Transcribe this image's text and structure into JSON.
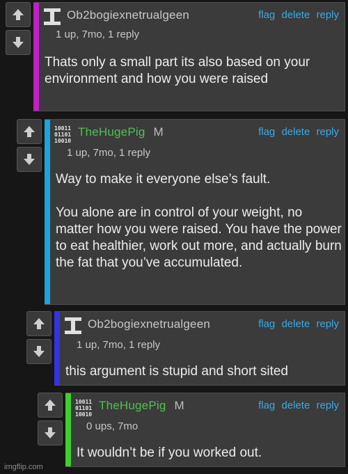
{
  "comments": [
    {
      "username": "Ob2bogiexnetrualgeen",
      "badge": "",
      "meta": "1 up, 7mo, 1 reply",
      "text": "Thats only a small part its also based on your environment and how you were raised",
      "stripe_color": "#c21fc6",
      "username_color": "#c8c8c8",
      "avatar": "i-beam-avatar"
    },
    {
      "username": "TheHugePig",
      "badge": "M",
      "meta": "1 up, 7mo, 1 reply",
      "text": "Way to make it everyone else’s fault.\n\nYou alone are in control of your weight, no matter how you were raised. You have the power to eat healthier, work out more, and actually burn the fat that you’ve accumulated.",
      "stripe_color": "#1ea3db",
      "username_color": "#4fc24f",
      "avatar": "binary-avatar"
    },
    {
      "username": "Ob2bogiexnetrualgeen",
      "badge": "",
      "meta": "1 up, 7mo, 1 reply",
      "text": "this argument is stupid and short sited",
      "stripe_color": "#3433e0",
      "username_color": "#c8c8c8",
      "avatar": "i-beam-avatar"
    },
    {
      "username": "TheHugePig",
      "badge": "M",
      "meta": "0 ups, 7mo",
      "text": "It wouldn’t be if you worked out.",
      "stripe_color": "#3bd12b",
      "username_color": "#4fc24f",
      "avatar": "binary-avatar"
    }
  ],
  "actions": {
    "flag": "flag",
    "delete": "delete",
    "reply": "reply"
  },
  "accent_color": "#3aa9e6",
  "watermark": "imgflip.com"
}
